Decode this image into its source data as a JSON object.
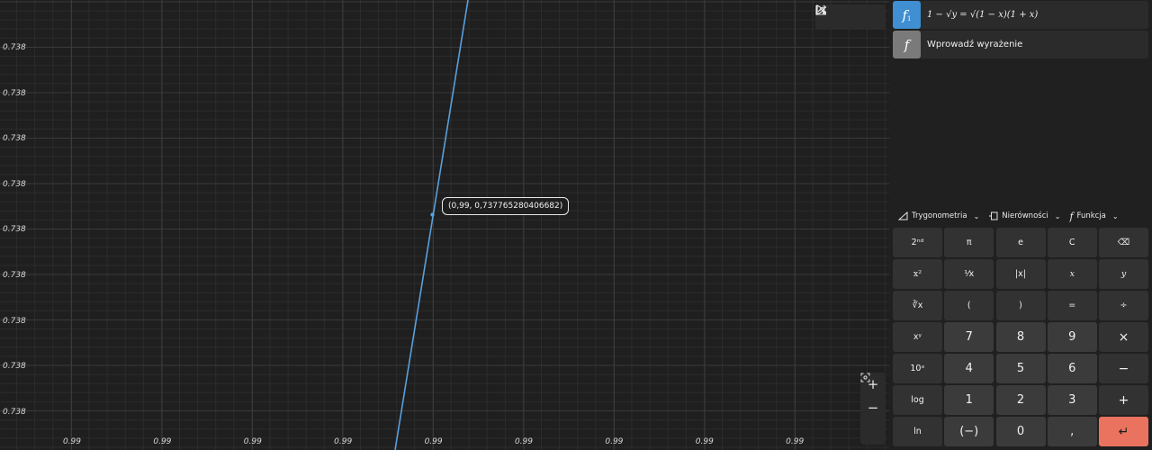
{
  "graph": {
    "y_ticks": [
      "0.738",
      "0.738",
      "0.738",
      "0.738",
      "0.738",
      "0.738",
      "0.738",
      "0.738",
      "0.738"
    ],
    "x_ticks": [
      "0.99",
      "0.99",
      "0.99",
      "0.99",
      "0.99",
      "0.99",
      "0.99",
      "0.99",
      "0.99"
    ],
    "point_label": "(0,99, 0,737765280406682)",
    "curve_color": "#5aa0dc",
    "toolbar": {
      "trace_icon": "cursor-trace-icon",
      "share_icon": "share-icon",
      "settings_icon": "graph-settings-icon"
    },
    "zoom": {
      "zoom_in": "+",
      "zoom_out": "−",
      "fit": "fit-view-icon"
    }
  },
  "functions": [
    {
      "icon_label": "f",
      "subscript": "1",
      "expression": "1 − √y = √(1 − x)(1 + x)",
      "color": "#3f8fd2"
    },
    {
      "icon_label": "f",
      "subscript": "",
      "placeholder": "Wprowadź wyrażenie",
      "color": "#7a7a7a"
    }
  ],
  "keypad_tabs": [
    {
      "label": "Trygonometria",
      "icon": "triangle-ruler-icon"
    },
    {
      "label": "Nierówności",
      "icon": "inequality-icon"
    },
    {
      "label": "Funkcja",
      "icon": "function-icon"
    }
  ],
  "keys": [
    [
      "2ⁿᵈ",
      "π",
      "e",
      "C",
      "⌫"
    ],
    [
      "x²",
      "¹⁄x",
      "|x|",
      "x",
      "y"
    ],
    [
      "∛x",
      "(",
      ")",
      "=",
      "÷"
    ],
    [
      "xʸ",
      "7",
      "8",
      "9",
      "×"
    ],
    [
      "10ˣ",
      "4",
      "5",
      "6",
      "−"
    ],
    [
      "log",
      "1",
      "2",
      "3",
      "+"
    ],
    [
      "ln",
      "(−)",
      "0",
      ",",
      "↵"
    ]
  ],
  "accent_color": "#e9735e"
}
